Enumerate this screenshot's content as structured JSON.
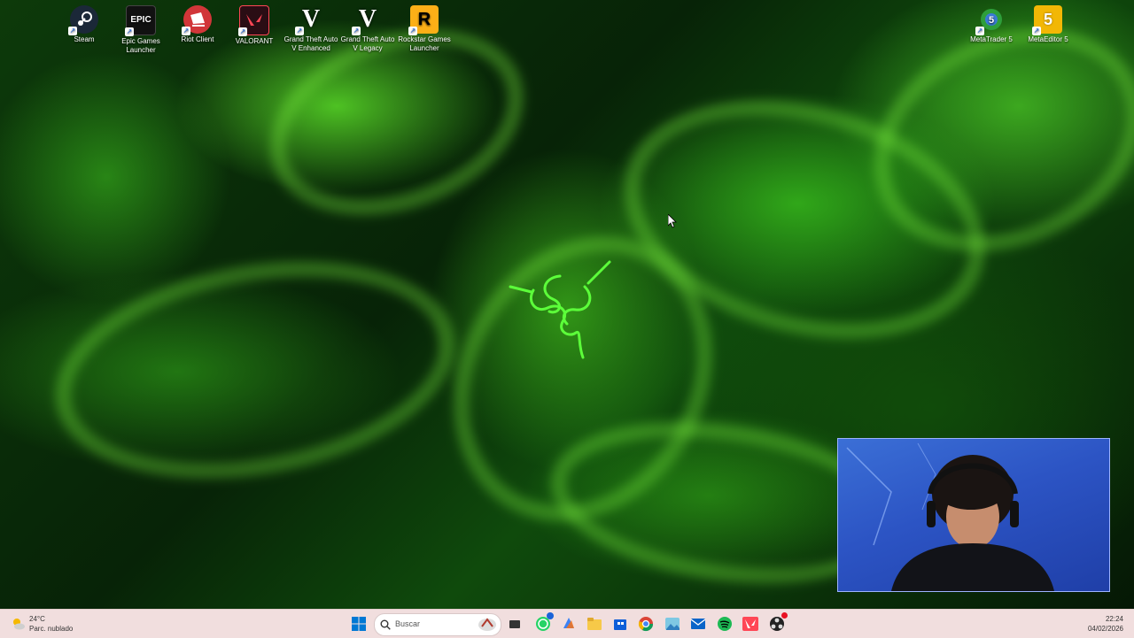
{
  "desktop": {
    "icons": [
      {
        "label": "Steam",
        "icon": "steam-icon",
        "color": "#1b2838"
      },
      {
        "label": "Epic Games Launcher",
        "icon": "epic-games-icon",
        "color": "#111111"
      },
      {
        "label": "Riot Client",
        "icon": "riot-client-icon",
        "color": "#d13639"
      },
      {
        "label": "VALORANT",
        "icon": "valorant-icon",
        "color": "#ff4655"
      },
      {
        "label": "Grand Theft Auto V Enhanced",
        "icon": "gta-v-icon",
        "color": "#ffffff"
      },
      {
        "label": "Grand Theft Auto V Legacy",
        "icon": "gta-v-icon",
        "color": "#ffffff"
      },
      {
        "label": "Rockstar Games Launcher",
        "icon": "rockstar-icon",
        "color": "#fcaf17"
      },
      {
        "label": "MetaTrader 5",
        "icon": "metatrader-icon",
        "color": "#2e9e3a"
      },
      {
        "label": "MetaEditor 5",
        "icon": "metaeditor-icon",
        "color": "#f2b705"
      }
    ]
  },
  "weather": {
    "temp": "24°C",
    "condition": "Parc. nublado"
  },
  "taskbar": {
    "search_placeholder": "Buscar",
    "apps": [
      "windows-start-icon",
      "search-icon",
      "task-view-icon",
      "whatsapp-icon",
      "copilot-icon",
      "file-explorer-icon",
      "store-icon",
      "chrome-icon",
      "photos-icon",
      "mail-icon",
      "spotify-icon",
      "valorant-taskbar-icon",
      "obs-icon"
    ]
  },
  "clock": {
    "time": "22:24",
    "date": "04/02/2026"
  },
  "colors": {
    "accent_green": "#44ff22",
    "taskbar_bg": "#f1dede",
    "start_blue": "#0078d4"
  }
}
